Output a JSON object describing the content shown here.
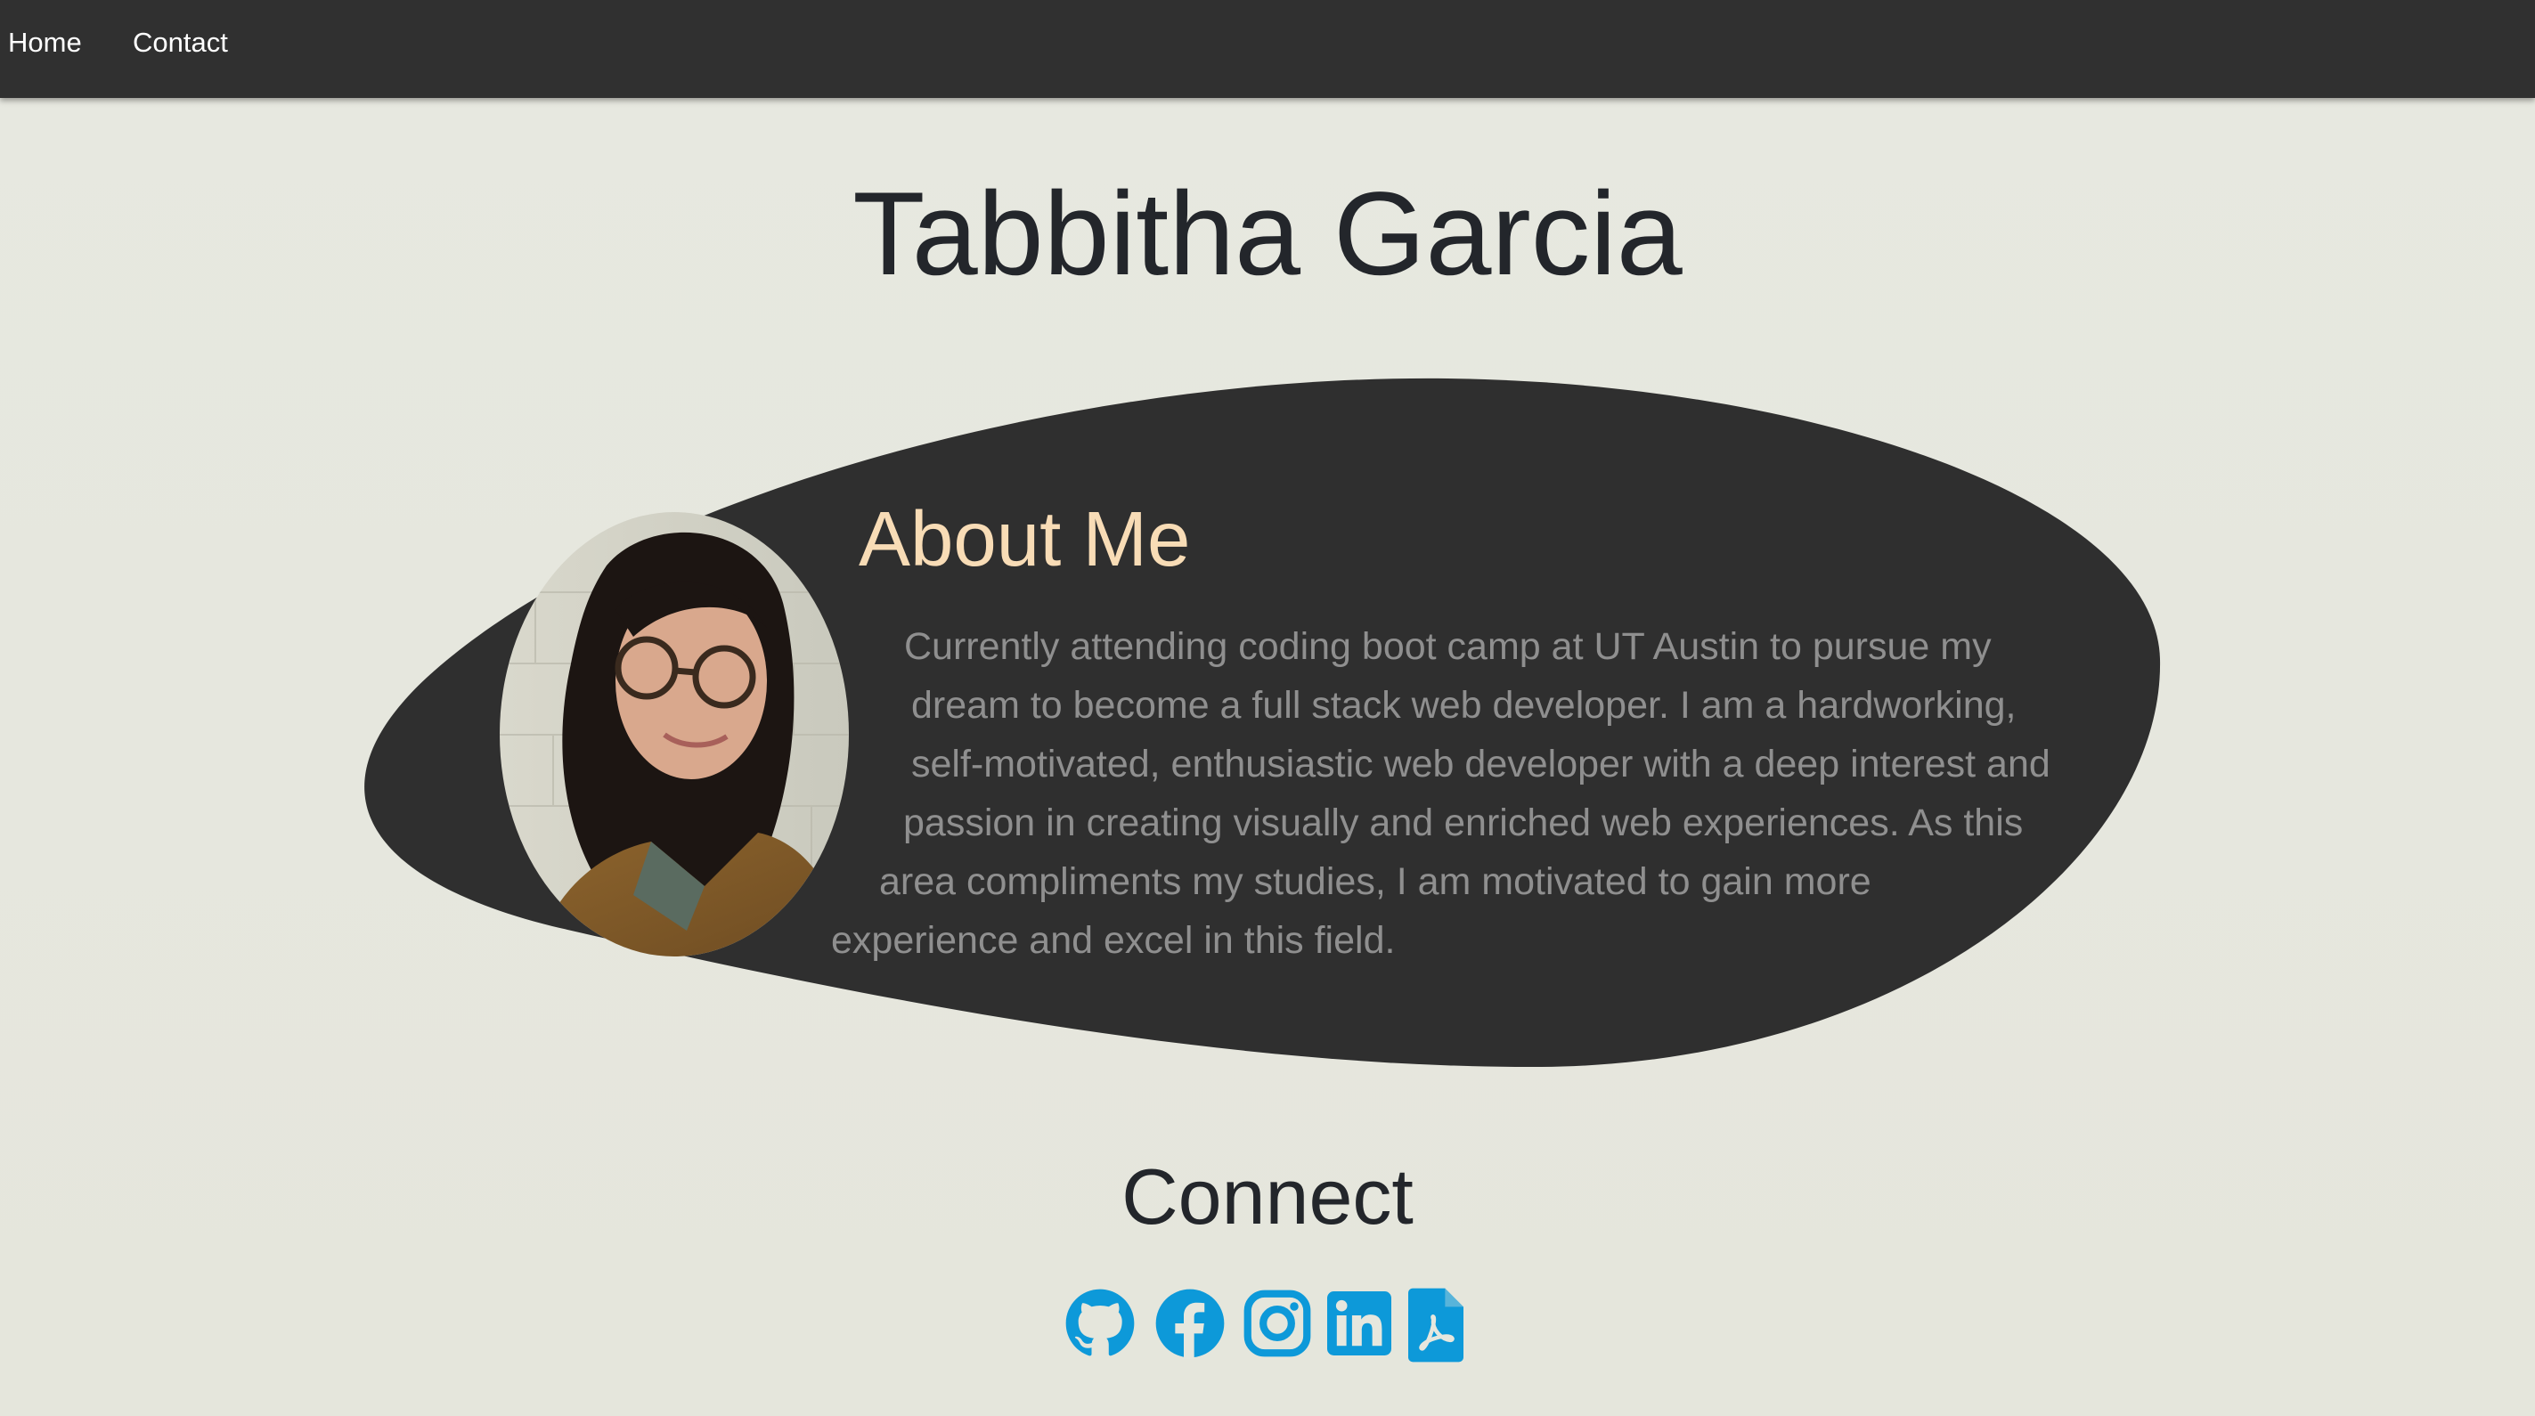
{
  "nav": {
    "home_label": "Home",
    "contact_label": "Contact"
  },
  "header": {
    "title": "Tabbitha Garcia"
  },
  "about": {
    "heading": "About Me",
    "lines": [
      "Currently attending coding boot camp at UT Austin to pursue my",
      "dream to become a full stack web developer. I am a hardworking,",
      "self-motivated, enthusiastic web developer with a deep interest and",
      "passion in creating visually and enriched web experiences. As this",
      "area compliments my studies, I am motivated to gain more",
      "experience and excel in this field."
    ]
  },
  "connect": {
    "heading": "Connect",
    "links": [
      {
        "icon": "github-icon"
      },
      {
        "icon": "facebook-icon"
      },
      {
        "icon": "instagram-icon"
      },
      {
        "icon": "linkedin-icon"
      },
      {
        "icon": "pdf-resume-icon"
      }
    ]
  },
  "colors": {
    "navbar": "#303030",
    "background": "#e6e7de",
    "blob": "#2f2f2f",
    "accent_heading": "#f8dcb6",
    "body_text": "#8f8f8f",
    "icon_blue": "#0d99d9",
    "title_text": "#23262b"
  }
}
